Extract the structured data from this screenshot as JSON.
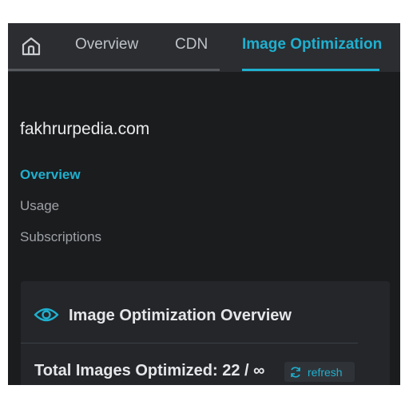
{
  "tabs": {
    "home_icon": "home-icon",
    "overview": "Overview",
    "cdn": "CDN",
    "image_optimization": "Image Optimization",
    "active": "Image Optimization"
  },
  "site": {
    "name": "fakhrurpedia.com"
  },
  "side_nav": {
    "items": [
      "Overview",
      "Usage",
      "Subscriptions"
    ],
    "active": "Overview"
  },
  "card": {
    "icon": "eye-icon",
    "title": "Image Optimization Overview",
    "stat_label": "Total Images Optimized: 22 / ∞",
    "refresh_label": "refresh",
    "refresh_icon": "refresh-icon"
  },
  "colors": {
    "accent": "#1fb0cf",
    "background": "#1b1c1e",
    "topbar": "#2b2d31",
    "card": "#24262a"
  }
}
